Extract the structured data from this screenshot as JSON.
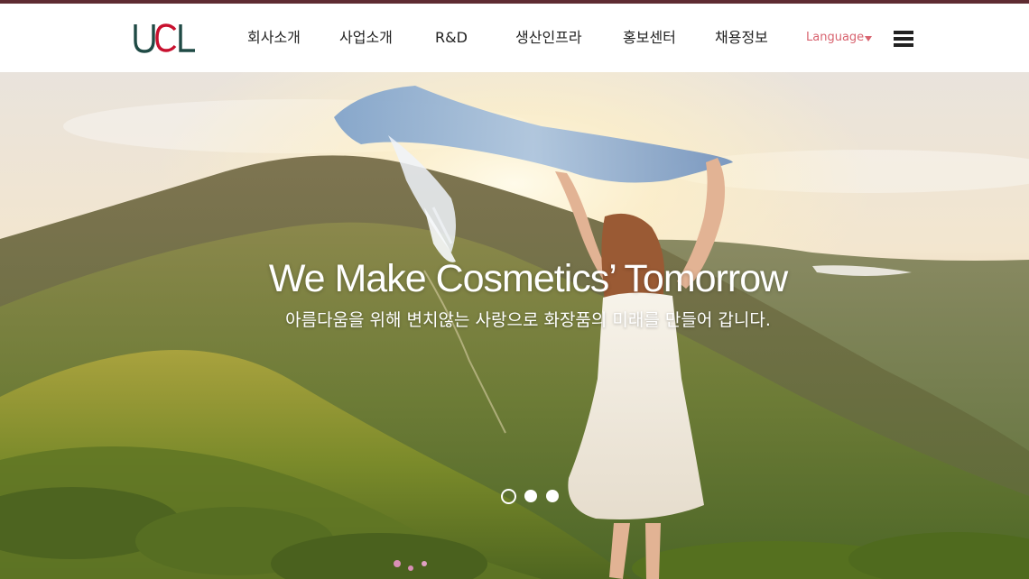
{
  "brand": {
    "logo_text": "UCL",
    "accent_color": "#5e2b32",
    "logo_c_color": "#c8102e",
    "logo_text_color": "#1f4a45"
  },
  "nav": {
    "items": [
      {
        "label": "회사소개"
      },
      {
        "label": "사업소개"
      },
      {
        "label": "R&D"
      },
      {
        "label": "생산인프라"
      },
      {
        "label": "홍보센터"
      },
      {
        "label": "채용정보"
      }
    ],
    "language_label": "Language",
    "language_color": "#d8636f",
    "menu_icon": "hamburger-menu-icon"
  },
  "hero": {
    "title": "We Make Cosmetics’ Tomorrow",
    "subtitle": "아름다움을 위해 변치않는 사랑으로 화장품의 미래를 만들어 갑니다.",
    "image": "woman with scarf on mountain at sunrise",
    "slides_total": 3,
    "active_slide": 1
  }
}
